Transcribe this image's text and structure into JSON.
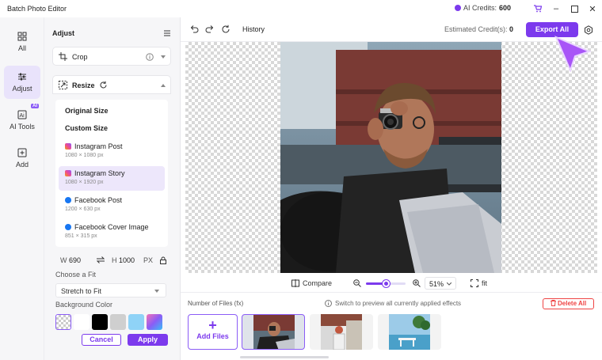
{
  "app": {
    "title": "Batch Photo Editor"
  },
  "titlebar": {
    "credits_label": "AI Credits:",
    "credits_value": "600"
  },
  "leftnav": {
    "items": [
      {
        "label": "All",
        "icon": "grid-icon"
      },
      {
        "label": "Adjust",
        "icon": "sliders-icon"
      },
      {
        "label": "AI Tools",
        "icon": "ai-tools-icon",
        "badge": "AI"
      },
      {
        "label": "Add",
        "icon": "add-icon"
      }
    ]
  },
  "adjust": {
    "title": "Adjust",
    "crop_label": "Crop",
    "resize_label": "Resize",
    "original_size": "Original Size",
    "custom_size": "Custom Size",
    "presets": [
      {
        "name": "Instagram Post",
        "dim": "1080 × 1080 px",
        "icon": "instagram-icon"
      },
      {
        "name": "Instagram Story",
        "dim": "1080 × 1920 px",
        "icon": "instagram-icon",
        "selected": true
      },
      {
        "name": "Facebook Post",
        "dim": "1200 × 630 px",
        "icon": "facebook-icon"
      },
      {
        "name": "Facebook Cover Image",
        "dim": "851 × 315 px",
        "icon": "facebook-icon"
      }
    ],
    "width_label": "W",
    "width_value": "690",
    "height_label": "H",
    "height_value": "1000",
    "unit": "PX",
    "fit_label": "Choose a Fit",
    "fit_value": "Stretch to Fit",
    "bg_label": "Background Color",
    "bg_colors": [
      "transparent",
      "#ffffff",
      "#000000",
      "#cfcfcf",
      "#8fd3f7",
      "gradient"
    ],
    "cancel": "Cancel",
    "apply": "Apply"
  },
  "toolbar": {
    "history": "History",
    "est_label": "Estimated Credit(s):",
    "est_value": "0",
    "export": "Export All"
  },
  "zoombar": {
    "compare": "Compare",
    "zoom": "51%",
    "fit": "fit",
    "zoom_level": 0.5
  },
  "files": {
    "label": "Number of Files (fx)",
    "hint": "Switch to preview all currently applied effects",
    "delete_all": "Delete All",
    "add_files": "Add Files"
  },
  "colors": {
    "accent": "#7c3aed",
    "danger": "#ef4444"
  }
}
